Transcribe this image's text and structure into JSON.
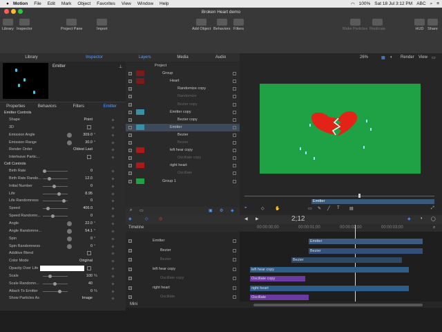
{
  "menubar": {
    "app": "Motion",
    "items": [
      "File",
      "Edit",
      "Mark",
      "Object",
      "Favorites",
      "View",
      "Window",
      "Help"
    ],
    "battery": "100%",
    "datetime": "Sat 18 Jul  3:12 PM",
    "input": "ABC"
  },
  "window": {
    "title": "Broken Heart demo"
  },
  "toolbar": {
    "library": "Library",
    "inspector": "Inspector",
    "project_pane": "Project Pane",
    "import": "Import",
    "add_object": "Add Object",
    "behaviors": "Behaviors",
    "filters": "Filters",
    "make_particles": "Make Particles",
    "replicate": "Replicate",
    "hud": "HUD",
    "share": "Share"
  },
  "panel_tabs": {
    "library": "Library",
    "inspector": "Inspector",
    "layers": "Layers",
    "media": "Media",
    "audio": "Audio"
  },
  "preview": {
    "name": "Emitter"
  },
  "inspector_tabs": [
    "Properties",
    "Behaviors",
    "Filters",
    "Emitter"
  ],
  "inspector": {
    "section1": "Emitter Controls",
    "rows1": [
      {
        "label": "Shape",
        "value": "Point"
      },
      {
        "label": "3D",
        "value": ""
      },
      {
        "label": "Emission Angle",
        "value": "309.0",
        "unit": "°"
      },
      {
        "label": "Emission Range",
        "value": "30.0",
        "unit": "°"
      },
      {
        "label": "Render Order",
        "value": "Oldest Last"
      },
      {
        "label": "Interleave Partic...",
        "value": ""
      }
    ],
    "section2": "Cell Controls",
    "rows2": [
      {
        "label": "Birth Rate",
        "value": "0"
      },
      {
        "label": "Birth Rate Rando...",
        "value": "12.0"
      },
      {
        "label": "Initial Number",
        "value": "0"
      },
      {
        "label": "Life",
        "value": "8.95"
      },
      {
        "label": "Life Randomness",
        "value": "0"
      },
      {
        "label": "Speed",
        "value": "406.0"
      },
      {
        "label": "Speed Randomn...",
        "value": "0"
      },
      {
        "label": "Angle",
        "value": "22.0",
        "unit": "°"
      },
      {
        "label": "Angle Randomne...",
        "value": "54.1",
        "unit": "°"
      },
      {
        "label": "Spin",
        "value": "0",
        "unit": "°"
      },
      {
        "label": "Spin Randomness",
        "value": "0",
        "unit": "°"
      },
      {
        "label": "Additive Blend",
        "value": ""
      },
      {
        "label": "Color Mode",
        "value": "Original"
      },
      {
        "label": "Opacity Over Life",
        "value": ""
      },
      {
        "label": "Scale",
        "value": "100",
        "unit": "%"
      },
      {
        "label": "Scale Randomn...",
        "value": "40"
      },
      {
        "label": "Attach To Emitter",
        "value": "0",
        "unit": "%"
      },
      {
        "label": "Show Particles As",
        "value": "Image"
      }
    ]
  },
  "layers": [
    {
      "name": "Project",
      "indent": 0
    },
    {
      "name": "Group",
      "indent": 1
    },
    {
      "name": "Heart",
      "indent": 2
    },
    {
      "name": "Randomize copy",
      "indent": 3
    },
    {
      "name": "Randomize",
      "indent": 3,
      "dim": true
    },
    {
      "name": "Bezier copy",
      "indent": 3,
      "dim": true
    },
    {
      "name": "Emitter copy",
      "indent": 2
    },
    {
      "name": "Bezier copy",
      "indent": 3
    },
    {
      "name": "Emitter",
      "indent": 2,
      "sel": true
    },
    {
      "name": "Bezier",
      "indent": 3
    },
    {
      "name": "Bezier",
      "indent": 3,
      "dim": true
    },
    {
      "name": "left hear copy",
      "indent": 2
    },
    {
      "name": "Oscillate copy",
      "indent": 3,
      "dim": true
    },
    {
      "name": "right heart",
      "indent": 2
    },
    {
      "name": "Oscillate",
      "indent": 3,
      "dim": true
    },
    {
      "name": "Group 1",
      "indent": 1
    }
  ],
  "canvas": {
    "zoom": "26%",
    "render": "Render",
    "view": "View"
  },
  "canvas_timeline": {
    "label": "Emitter"
  },
  "playback": {
    "timecode": "2;12"
  },
  "timeline": {
    "label": "Timeline",
    "ruler": [
      "00:00:00;00",
      "00:00:01;00",
      "00:00:02;00",
      "00:00:03;00"
    ],
    "mini": "Mini"
  },
  "tl_layers": [
    {
      "name": "Emitter",
      "indent": 1
    },
    {
      "name": "Bezier",
      "indent": 2
    },
    {
      "name": "Bezier",
      "indent": 2,
      "dim": true
    },
    {
      "name": "left hear copy",
      "indent": 1
    },
    {
      "name": "Oscillate copy",
      "indent": 2,
      "dim": true
    },
    {
      "name": "right heart",
      "indent": 1
    },
    {
      "name": "Oscillate",
      "indent": 2,
      "dim": true
    }
  ],
  "tl_bars": [
    {
      "label": "Emitter"
    },
    {
      "label": "Bezier"
    },
    {
      "label": "Bezier"
    },
    {
      "label": "left hear copy"
    },
    {
      "label": "Oscillate copy"
    },
    {
      "label": "right heart"
    },
    {
      "label": "Oscillate"
    }
  ]
}
